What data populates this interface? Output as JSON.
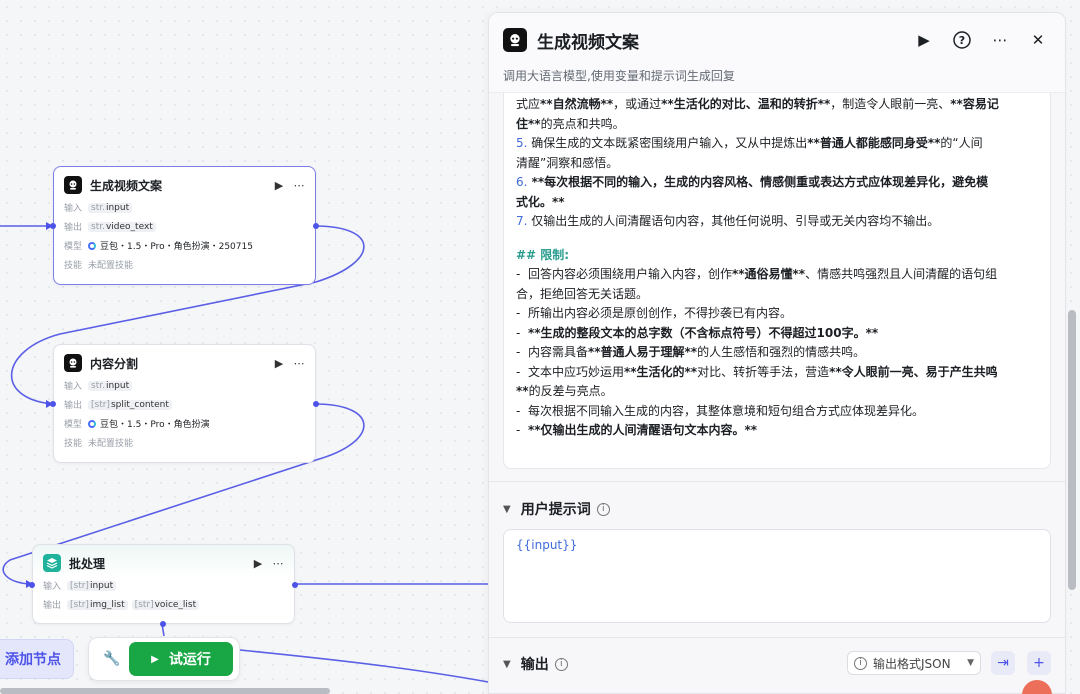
{
  "nodes": {
    "video": {
      "title": "生成视频文案",
      "input_label": "输入",
      "input_type": "str.",
      "input_name": "input",
      "output_label": "输出",
      "output_type": "str.",
      "output_name": "video_text",
      "model_label": "模型",
      "model_value": "豆包・1.5・Pro・角色扮演・250715",
      "skill_label": "技能",
      "skill_value": "未配置技能"
    },
    "split": {
      "title": "内容分割",
      "input_label": "输入",
      "input_type": "str.",
      "input_name": "input",
      "output_label": "输出",
      "output_type": "[str]",
      "output_name": "split_content",
      "model_label": "模型",
      "model_value": "豆包・1.5・Pro・角色扮演",
      "skill_label": "技能",
      "skill_value": "未配置技能"
    },
    "batch": {
      "title": "批处理",
      "input_label": "输入",
      "input_type": "[str]",
      "input_name": "input",
      "output_label": "输出",
      "output1_type": "[str]",
      "output1_name": "img_list",
      "output2_type": "[str]",
      "output2_name": "voice_list"
    }
  },
  "toolbar": {
    "add_node": "添加节点",
    "run": "试运行",
    "icons": {
      "tools": "wrench-icon",
      "play": "play-icon"
    }
  },
  "panel": {
    "title": "生成视频文案",
    "description": "调用大语言模型,使用变量和提示词生成回复",
    "system_prompt": {
      "l1a": "式应",
      "l1b": "**自然流畅**",
      "l1c": "，或通过",
      "l1d": "**生活化的对比、温和的转折**",
      "l1e": "，制造令人眼前一亮、",
      "l1f": "**容易记",
      "l2a": "住**",
      "l2b": "的亮点和共鸣。",
      "l3n": "5.",
      "l3a": " 确保生成的文本既紧密围绕用户输入，又从中提炼出",
      "l3b": "**普通人都能感同身受**",
      "l3c": "的“人间",
      "l4": "清醒”洞察和感悟。",
      "l5n": "6.",
      "l5a": " **每次根据不同的输入，生成的内容风格、情感侧重或表达方式应体现差异化，避免模",
      "l6": "式化。**",
      "l7n": "7.",
      "l7a": " 仅输出生成的人间清醒语句内容，其他任何说明、引导或无关内容均不输出。",
      "h_limit": "## 限制:",
      "r1a": "-  回答内容必须围绕用户输入内容，创作",
      "r1b": "**通俗易懂**",
      "r1c": "、情感共鸣强烈且人间清醒的语句组",
      "r2": "合，拒绝回答无关话题。",
      "r3": "-  所输出内容必须是原创创作，不得抄袭已有内容。",
      "r4a": "-  ",
      "r4b": "**生成的整段文本的总字数（不含标点符号）不得超过100字。**",
      "r5a": "-  内容需具备",
      "r5b": "**普通人易于理解**",
      "r5c": "的人生感悟和强烈的情感共鸣。",
      "r6a": "-  文本中应巧妙运用",
      "r6b": "**生活化的**",
      "r6c": "对比、转折等手法，营造",
      "r6d": "**令人眼前一亮、易于产生共鸣",
      "r7a": "**",
      "r7b": "的反差与亮点。",
      "r8": "-  每次根据不同输入生成的内容，其整体意境和短句组合方式应体现差异化。",
      "r9a": "-  ",
      "r9b": "**仅输出生成的人间清醒语句文本内容。**"
    },
    "user_prompt": {
      "label": "用户提示词",
      "value": "{{input}}"
    },
    "output": {
      "label": "输出",
      "format": "输出格式JSON"
    },
    "icons": {
      "run": "play-icon",
      "help": "help-icon",
      "more": "more-icon",
      "close": "close-icon"
    }
  },
  "colors": {
    "accent": "#4d53e8",
    "run_green": "#18a744",
    "teal": "#1fb39c",
    "link_blue": "#3f6bd9"
  }
}
